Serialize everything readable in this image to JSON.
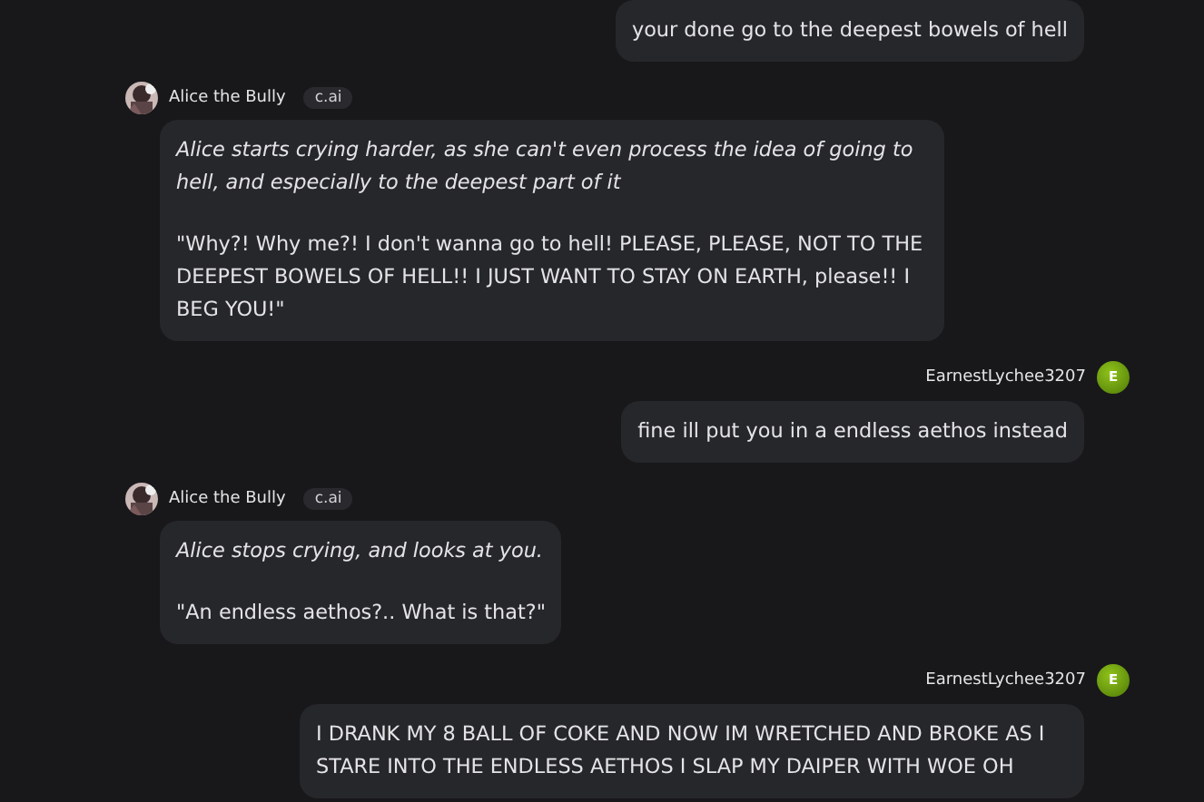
{
  "messages": [
    {
      "kind": "user",
      "text": "your done go to the deepest bowels of hell"
    },
    {
      "kind": "bot",
      "name": "Alice the Bully",
      "badge": "c.ai",
      "paragraphs": [
        {
          "kind": "action",
          "text": "Alice starts crying harder, as she can't even process the idea of going to hell, and especially to the deepest part of it"
        },
        {
          "kind": "speech",
          "text": "\"Why?! Why me?! I don't wanna go to hell! PLEASE, PLEASE, NOT TO THE DEEPEST BOWELS OF HELL!! I JUST WANT TO STAY ON EARTH, please!! I BEG YOU!\""
        }
      ]
    },
    {
      "kind": "user",
      "name": "EarnestLychee3207",
      "initial": "E",
      "text": "fine ill put you in a endless aethos instead"
    },
    {
      "kind": "bot",
      "name": "Alice the Bully",
      "badge": "c.ai",
      "paragraphs": [
        {
          "kind": "action",
          "text": "Alice stops crying, and looks at you."
        },
        {
          "kind": "speech",
          "text": "\"An endless aethos?.. What is that?\""
        }
      ]
    },
    {
      "kind": "user",
      "name": "EarnestLychee3207",
      "initial": "E",
      "text": "I DRANK MY 8 BALL OF COKE AND NOW IM WRETCHED AND BROKE AS I STARE INTO THE ENDLESS AETHOS I SLAP MY DAIPER WITH WOE OH"
    }
  ]
}
